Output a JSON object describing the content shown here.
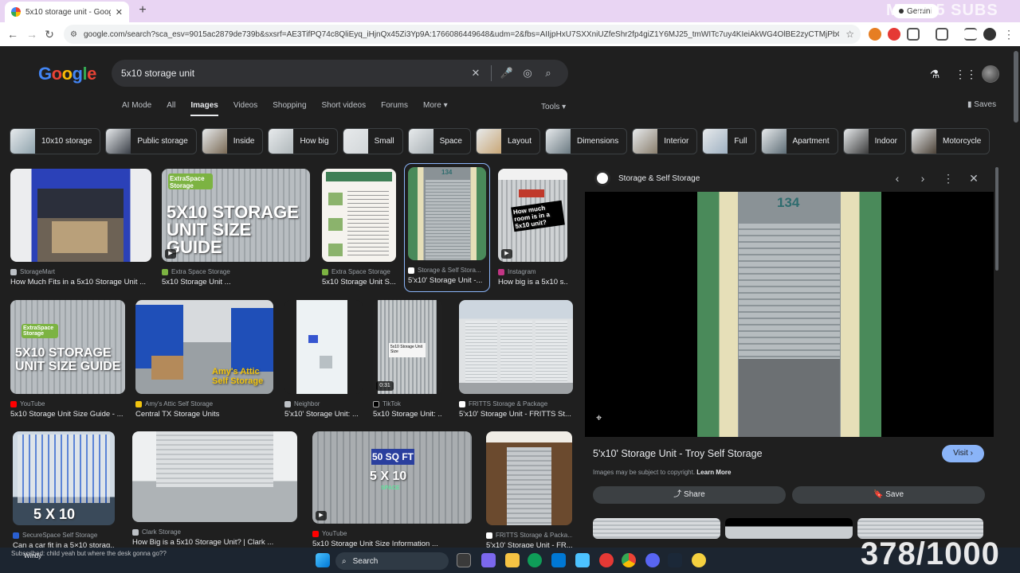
{
  "browser": {
    "tab_title": "5x10 storage unit - Google Search",
    "new_tab": "+",
    "tab_close": "✕",
    "gemini_label": "Gemini",
    "url": "google.com/search?sca_esv=9015ac2879de739b&sxsrf=AE3TifPQ74c8QliEyq_iHjnQx45Zi3Yp9A:1766086449648&udm=2&fbs=AIIjpHxU7SXXniUZfeShr2fp4giZ1Y6MJ25_tmWITc7uy4KIeiAkWG4OlBE2zyCTMjPbGmMU8EWskMk2JS..."
  },
  "overlay": {
    "top_text": "MY #15 SUBS",
    "counter": "378/1000",
    "chat": "Subscribed: child yeah but where the desk gonna go??",
    "weather": "Windy"
  },
  "google": {
    "logo_letters": [
      "G",
      "o",
      "o",
      "g",
      "l",
      "e"
    ],
    "logo_colors": [
      "#4285f4",
      "#ea4335",
      "#fbbc05",
      "#4285f4",
      "#34a853",
      "#ea4335"
    ],
    "query": "5x10 storage unit",
    "tabs": [
      "AI Mode",
      "All",
      "Images",
      "Videos",
      "Shopping",
      "Short videos",
      "Forums",
      "More ▾"
    ],
    "active_tab": "Images",
    "tools": "Tools ▾",
    "saves": "Saves"
  },
  "chips": [
    "10x10 storage",
    "Public storage",
    "Inside",
    "How big",
    "Small",
    "Space",
    "Layout",
    "Dimensions",
    "Interior",
    "Full",
    "Apartment",
    "Indoor",
    "Motorcycle"
  ],
  "results": {
    "row1": [
      {
        "source": "StorageMart",
        "title": "How Much Fits in a 5x10 Storage Unit ..."
      },
      {
        "source": "Extra Space Storage",
        "title": "5x10 Storage Unit ...",
        "overlay": "5X10 STORAGE UNIT SIZE GUIDE",
        "badge": "ExtraSpace Storage"
      },
      {
        "source": "Extra Space Storage",
        "title": "5x10 Storage Unit S..."
      },
      {
        "source": "Storage & Self Stora...",
        "title": "5'x10' Storage Unit -...",
        "unit_no": "134"
      },
      {
        "source": "Instagram",
        "title": "How big is a 5x10 s...",
        "overlay": "How much room is in a 5x10 unit?"
      }
    ],
    "row2": [
      {
        "source": "YouTube",
        "title": "5x10 Storage Unit Size Guide - ...",
        "overlay": "5X10 STORAGE UNIT SIZE GUIDE",
        "badge": "ExtraSpace Storage"
      },
      {
        "source": "Amy's Attic Self Storage",
        "title": "Central TX Storage Units",
        "overlay": "Amy's Attic Self Storage"
      },
      {
        "source": "Neighbor",
        "title": "5'x10' Storage Unit: ..."
      },
      {
        "source": "TikTok",
        "title": "5x10 Storage Unit: ...",
        "duration": "0:31"
      },
      {
        "source": "FRITTS Storage & Package",
        "title": "5'x10' Storage Unit - FRITTS St..."
      }
    ],
    "row3": [
      {
        "source": "SecureSpace Self Storage",
        "title": "Can a car fit in a 5×10 storag...",
        "overlay": "5 X 10"
      },
      {
        "source": "Clark Storage",
        "title": "How Big is a 5x10 Storage Unit? | Clark ..."
      },
      {
        "source": "YouTube",
        "title": "5x10 Storage Unit Size Information ...",
        "overlay_a": "50 SQ FT",
        "overlay_b": "5 X 10",
        "overlay_c": "SPACE"
      },
      {
        "source": "FRITTS Storage & Packa...",
        "title": "5'x10' Storage Unit - FR..."
      }
    ]
  },
  "panel": {
    "site": "Storage & Self Storage",
    "unit_no": "134",
    "title": "5'x10' Storage Unit - Troy Self Storage",
    "visit": "Visit ›",
    "copyright": "Images may be subject to copyright.",
    "learn_more": "Learn More",
    "share": "⤴ Share",
    "save": "🔖 Save"
  },
  "taskbar": {
    "search": "Search"
  }
}
